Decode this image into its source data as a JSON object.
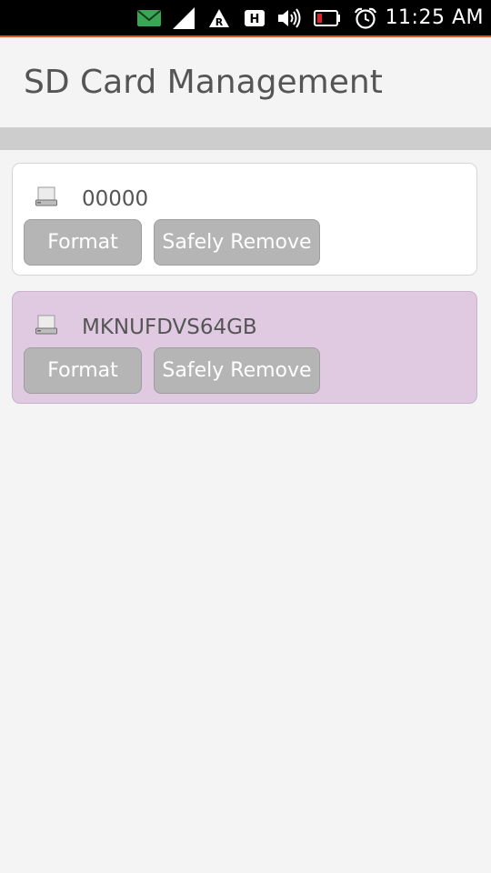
{
  "status_bar": {
    "time": "11:25 AM",
    "icons": [
      "message-icon",
      "signal-icon",
      "roaming-icon",
      "hspa-icon",
      "volume-icon",
      "battery-low-icon",
      "alarm-icon"
    ],
    "colors": {
      "message": "#3aa655",
      "battery_low": "#e0202a",
      "accent_line": "#e5541a"
    }
  },
  "header": {
    "title": "SD Card Management"
  },
  "cards": [
    {
      "label": "00000",
      "icon": "drive-icon",
      "format_label": "Format",
      "remove_label": "Safely Remove",
      "highlighted": false
    },
    {
      "label": "MKNUFDVS64GB",
      "icon": "drive-icon",
      "format_label": "Format",
      "remove_label": "Safely Remove",
      "highlighted": true,
      "highlight_color": "#dfcae2"
    }
  ]
}
